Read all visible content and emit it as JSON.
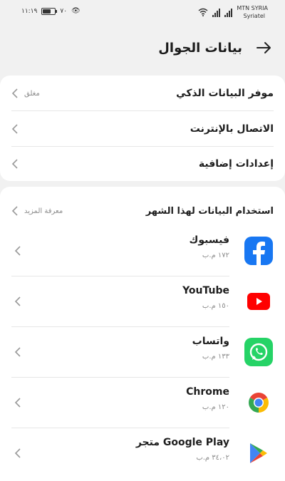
{
  "status_bar": {
    "time": "١١:١٩",
    "battery": "٧٠",
    "battery_level": 0.7,
    "carrier_top": "MTN SYRIA",
    "carrier_bottom": "Syriatel"
  },
  "header": {
    "title": "بيانات الجوال"
  },
  "settings": [
    {
      "label": "موفر البيانات الذكي",
      "value": "مغلق"
    },
    {
      "label": "الاتصال بالإنترنت",
      "value": ""
    },
    {
      "label": "إعدادات إضافية",
      "value": ""
    }
  ],
  "usage_section": {
    "title": "استخدام البيانات لهذا الشهر",
    "learn_more": "معرفة المزيد"
  },
  "apps": [
    {
      "name": "فيسبوك",
      "usage": "١٧٢ م.ب",
      "icon": "facebook-icon"
    },
    {
      "name": "YouTube",
      "usage": "١٥٠ م.ب",
      "icon": "youtube-icon"
    },
    {
      "name": "واتساب",
      "usage": "١٣٣ م.ب",
      "icon": "whatsapp-icon"
    },
    {
      "name": "Chrome",
      "usage": "١٢٠ م.ب",
      "icon": "chrome-icon"
    },
    {
      "name": "متجر Google Play",
      "usage": "٣٤،٠٢ م.ب",
      "icon": "google-play-icon"
    }
  ],
  "colors": {
    "facebook": "#1877f2",
    "youtube": "#ff0000",
    "whatsapp": "#25d366",
    "chrome_red": "#ea4335",
    "chrome_yellow": "#fbbc05",
    "chrome_green": "#34a853",
    "chrome_blue": "#4285f4"
  }
}
